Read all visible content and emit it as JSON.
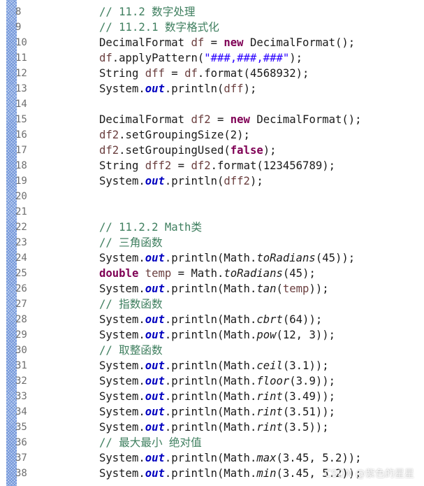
{
  "editor": {
    "lines": [
      {
        "num": "8",
        "tokens": [
          {
            "t": "// 11.2 ",
            "c": "comment"
          },
          {
            "t": "数字处理",
            "c": "comment cn"
          }
        ]
      },
      {
        "num": "9",
        "tokens": [
          {
            "t": "// 11.2.1 ",
            "c": "comment"
          },
          {
            "t": "数字格式化",
            "c": "comment cn"
          }
        ]
      },
      {
        "num": "10",
        "tokens": [
          {
            "t": "DecimalFormat ",
            "c": ""
          },
          {
            "t": "df",
            "c": "var"
          },
          {
            "t": " = ",
            "c": ""
          },
          {
            "t": "new",
            "c": "kw"
          },
          {
            "t": " DecimalFormat();",
            "c": ""
          }
        ]
      },
      {
        "num": "11",
        "tokens": [
          {
            "t": "df",
            "c": "var"
          },
          {
            "t": ".applyPattern(",
            "c": ""
          },
          {
            "t": "\"###,###,###\"",
            "c": "str"
          },
          {
            "t": ");",
            "c": ""
          }
        ]
      },
      {
        "num": "12",
        "tokens": [
          {
            "t": "String ",
            "c": ""
          },
          {
            "t": "dff",
            "c": "var"
          },
          {
            "t": " = ",
            "c": ""
          },
          {
            "t": "df",
            "c": "var"
          },
          {
            "t": ".format(4568932);",
            "c": ""
          }
        ]
      },
      {
        "num": "13",
        "tokens": [
          {
            "t": "System.",
            "c": ""
          },
          {
            "t": "out",
            "c": "fld"
          },
          {
            "t": ".println(",
            "c": ""
          },
          {
            "t": "dff",
            "c": "var"
          },
          {
            "t": ");",
            "c": ""
          }
        ]
      },
      {
        "num": "14",
        "tokens": []
      },
      {
        "num": "15",
        "tokens": [
          {
            "t": "DecimalFormat ",
            "c": ""
          },
          {
            "t": "df2",
            "c": "var"
          },
          {
            "t": " = ",
            "c": ""
          },
          {
            "t": "new",
            "c": "kw"
          },
          {
            "t": " DecimalFormat();",
            "c": ""
          }
        ]
      },
      {
        "num": "16",
        "tokens": [
          {
            "t": "df2",
            "c": "var"
          },
          {
            "t": ".setGroupingSize(2);",
            "c": ""
          }
        ]
      },
      {
        "num": "17",
        "tokens": [
          {
            "t": "df2",
            "c": "var"
          },
          {
            "t": ".setGroupingUsed(",
            "c": ""
          },
          {
            "t": "false",
            "c": "kw"
          },
          {
            "t": ");",
            "c": ""
          }
        ]
      },
      {
        "num": "18",
        "tokens": [
          {
            "t": "String ",
            "c": ""
          },
          {
            "t": "dff2",
            "c": "var"
          },
          {
            "t": " = ",
            "c": ""
          },
          {
            "t": "df2",
            "c": "var"
          },
          {
            "t": ".format(123456789);",
            "c": ""
          }
        ]
      },
      {
        "num": "19",
        "tokens": [
          {
            "t": "System.",
            "c": ""
          },
          {
            "t": "out",
            "c": "fld"
          },
          {
            "t": ".println(",
            "c": ""
          },
          {
            "t": "dff2",
            "c": "var"
          },
          {
            "t": ");",
            "c": ""
          }
        ]
      },
      {
        "num": "20",
        "tokens": []
      },
      {
        "num": "21",
        "tokens": []
      },
      {
        "num": "22",
        "tokens": [
          {
            "t": "// 11.2.2 Math",
            "c": "comment"
          },
          {
            "t": "类",
            "c": "comment cn"
          }
        ]
      },
      {
        "num": "23",
        "tokens": [
          {
            "t": "// ",
            "c": "comment"
          },
          {
            "t": "三角函数",
            "c": "comment cn"
          }
        ]
      },
      {
        "num": "24",
        "tokens": [
          {
            "t": "System.",
            "c": ""
          },
          {
            "t": "out",
            "c": "fld"
          },
          {
            "t": ".println(Math.",
            "c": ""
          },
          {
            "t": "toRadians",
            "c": "it"
          },
          {
            "t": "(45));",
            "c": ""
          }
        ]
      },
      {
        "num": "25",
        "tokens": [
          {
            "t": "double",
            "c": "kw"
          },
          {
            "t": " ",
            "c": ""
          },
          {
            "t": "temp",
            "c": "var"
          },
          {
            "t": " = Math.",
            "c": ""
          },
          {
            "t": "toRadians",
            "c": "it"
          },
          {
            "t": "(45);",
            "c": ""
          }
        ]
      },
      {
        "num": "26",
        "tokens": [
          {
            "t": "System.",
            "c": ""
          },
          {
            "t": "out",
            "c": "fld"
          },
          {
            "t": ".println(Math.",
            "c": ""
          },
          {
            "t": "tan",
            "c": "it"
          },
          {
            "t": "(",
            "c": ""
          },
          {
            "t": "temp",
            "c": "var"
          },
          {
            "t": "));",
            "c": ""
          }
        ]
      },
      {
        "num": "27",
        "tokens": [
          {
            "t": "// ",
            "c": "comment"
          },
          {
            "t": "指数函数",
            "c": "comment cn"
          }
        ]
      },
      {
        "num": "28",
        "tokens": [
          {
            "t": "System.",
            "c": ""
          },
          {
            "t": "out",
            "c": "fld"
          },
          {
            "t": ".println(Math.",
            "c": ""
          },
          {
            "t": "cbrt",
            "c": "it"
          },
          {
            "t": "(64));",
            "c": ""
          }
        ]
      },
      {
        "num": "29",
        "tokens": [
          {
            "t": "System.",
            "c": ""
          },
          {
            "t": "out",
            "c": "fld"
          },
          {
            "t": ".println(Math.",
            "c": ""
          },
          {
            "t": "pow",
            "c": "it"
          },
          {
            "t": "(12, 3));",
            "c": ""
          }
        ]
      },
      {
        "num": "30",
        "tokens": [
          {
            "t": "// ",
            "c": "comment"
          },
          {
            "t": "取整函数",
            "c": "comment cn"
          }
        ]
      },
      {
        "num": "31",
        "tokens": [
          {
            "t": "System.",
            "c": ""
          },
          {
            "t": "out",
            "c": "fld"
          },
          {
            "t": ".println(Math.",
            "c": ""
          },
          {
            "t": "ceil",
            "c": "it"
          },
          {
            "t": "(3.1));",
            "c": ""
          }
        ]
      },
      {
        "num": "32",
        "tokens": [
          {
            "t": "System.",
            "c": ""
          },
          {
            "t": "out",
            "c": "fld"
          },
          {
            "t": ".println(Math.",
            "c": ""
          },
          {
            "t": "floor",
            "c": "it"
          },
          {
            "t": "(3.9));",
            "c": ""
          }
        ]
      },
      {
        "num": "33",
        "tokens": [
          {
            "t": "System.",
            "c": ""
          },
          {
            "t": "out",
            "c": "fld"
          },
          {
            "t": ".println(Math.",
            "c": ""
          },
          {
            "t": "rint",
            "c": "it"
          },
          {
            "t": "(3.49));",
            "c": ""
          }
        ]
      },
      {
        "num": "34",
        "tokens": [
          {
            "t": "System.",
            "c": ""
          },
          {
            "t": "out",
            "c": "fld"
          },
          {
            "t": ".println(Math.",
            "c": ""
          },
          {
            "t": "rint",
            "c": "it"
          },
          {
            "t": "(3.51));",
            "c": ""
          }
        ]
      },
      {
        "num": "35",
        "tokens": [
          {
            "t": "System.",
            "c": ""
          },
          {
            "t": "out",
            "c": "fld"
          },
          {
            "t": ".println(Math.",
            "c": ""
          },
          {
            "t": "rint",
            "c": "it"
          },
          {
            "t": "(3.5));",
            "c": ""
          }
        ]
      },
      {
        "num": "36",
        "tokens": [
          {
            "t": "// ",
            "c": "comment"
          },
          {
            "t": "最大最小 绝对值",
            "c": "comment cn"
          }
        ]
      },
      {
        "num": "37",
        "tokens": [
          {
            "t": "System.",
            "c": ""
          },
          {
            "t": "out",
            "c": "fld"
          },
          {
            "t": ".println(Math.",
            "c": ""
          },
          {
            "t": "max",
            "c": "it"
          },
          {
            "t": "(3.45, 5.2));",
            "c": ""
          }
        ]
      },
      {
        "num": "38",
        "tokens": [
          {
            "t": "System.",
            "c": ""
          },
          {
            "t": "out",
            "c": "fld"
          },
          {
            "t": ".println(Math.",
            "c": ""
          },
          {
            "t": "min",
            "c": "it"
          },
          {
            "t": "(3.45, 5.2));",
            "c": ""
          }
        ]
      }
    ]
  },
  "watermark": "CSDN @紫色的星星",
  "colors": {
    "keyword": "#7f0055",
    "comment": "#3f7f5f",
    "string": "#2a00ff",
    "field": "#0000c0",
    "variable": "#6a3e3e",
    "line_number": "#6e6e6e"
  }
}
